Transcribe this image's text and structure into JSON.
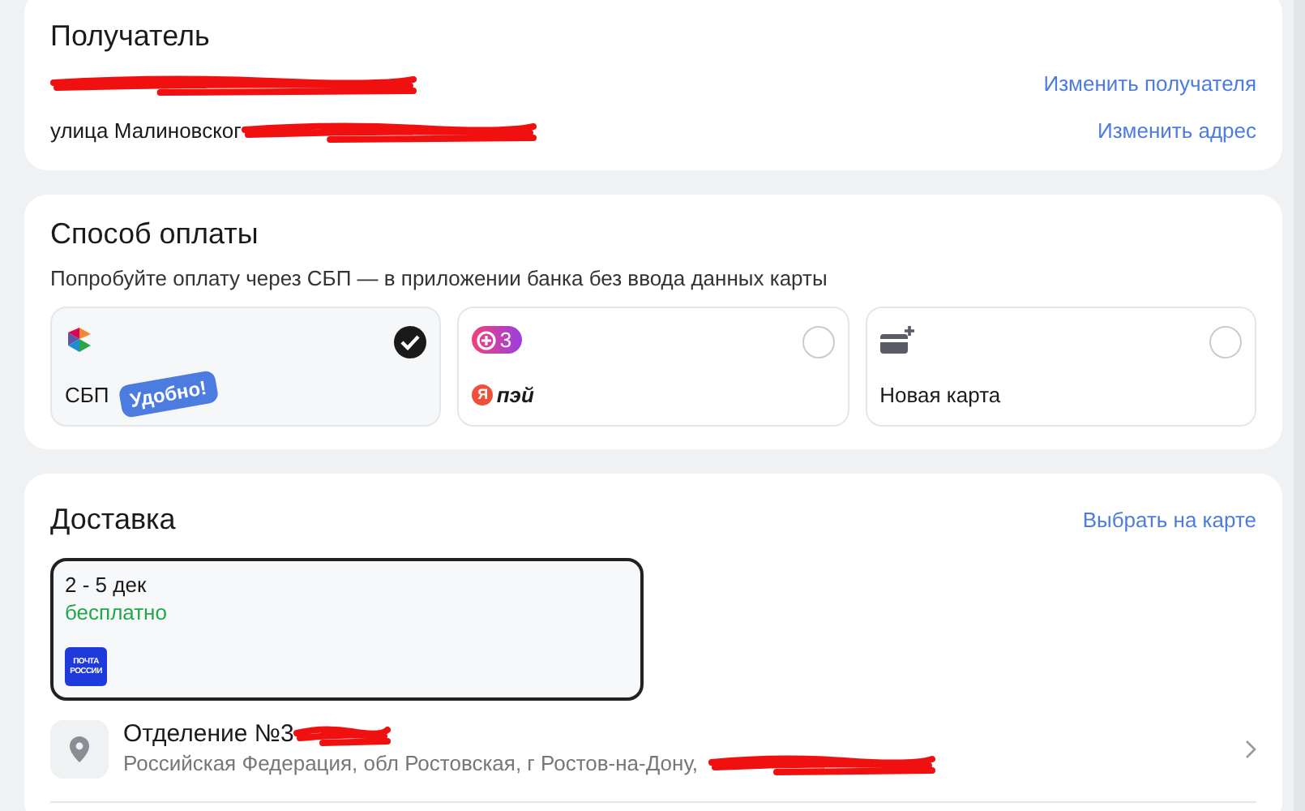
{
  "recipient": {
    "title": "Получатель",
    "lines": [
      {
        "redacted": true,
        "link": "Изменить получателя"
      },
      {
        "text": "улица Малиновског",
        "redacted": true,
        "link": "Изменить адрес"
      }
    ]
  },
  "payment": {
    "title": "Способ оплаты",
    "hint": "Попробуйте оплату через СБП — в приложении банка без ввода данных карты",
    "options": [
      {
        "kind": "sbp",
        "label": "СБП",
        "badge": "Удобно!",
        "selected": true
      },
      {
        "kind": "yapay",
        "bonus": "3",
        "logo_letter": "Я",
        "label": "пэй",
        "selected": false
      },
      {
        "kind": "card",
        "label": "Новая карта",
        "selected": false
      }
    ]
  },
  "delivery": {
    "title": "Доставка",
    "map_link": "Выбрать на карте",
    "options": [
      {
        "dates": "2 - 5 дек",
        "price": "бесплатно",
        "carrier_logo": "ПОЧТА РОССИИ",
        "selected": true
      }
    ],
    "pickup": {
      "title": "Отделение №3",
      "title_redacted": true,
      "address": "Российская Федерация, обл Ростовская, г Ростов-на-Дону,",
      "address_redacted": true
    }
  }
}
